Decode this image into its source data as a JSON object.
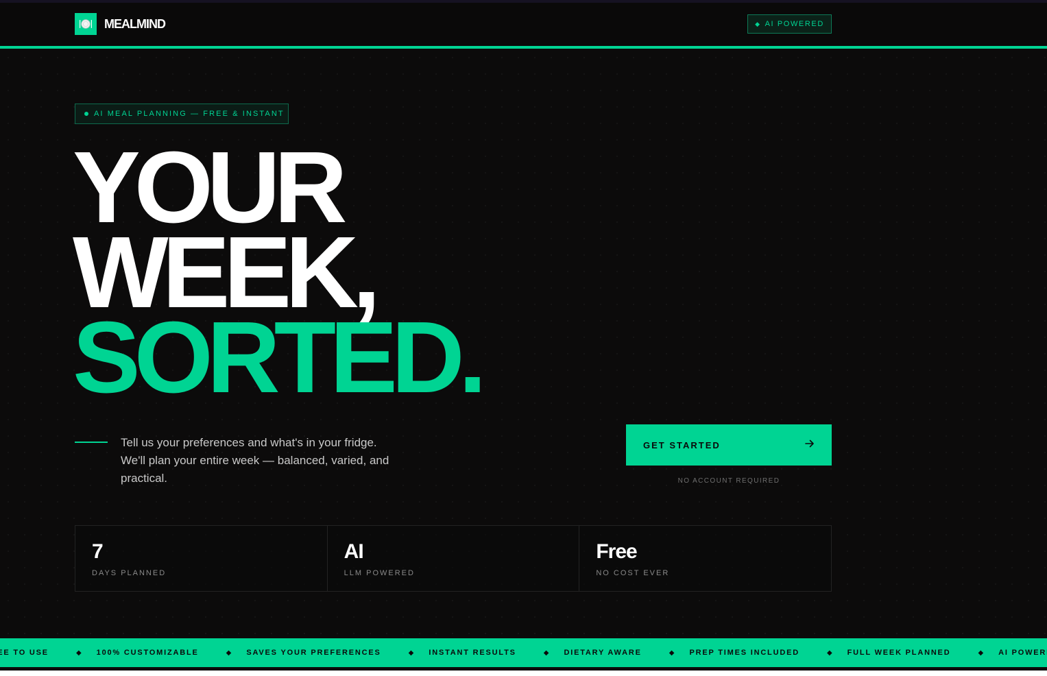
{
  "header": {
    "logo_text": "MEALMIND",
    "logo_icon": "plate-icon",
    "badge_label": "AI POWERED"
  },
  "hero": {
    "eyebrow": "AI MEAL PLANNING — FREE & INSTANT",
    "headline_line1": "YOUR",
    "headline_line2": "WEEK,",
    "headline_line3": "SORTED.",
    "subcopy": "Tell us your preferences and what's in your fridge. We'll plan your entire week — balanced, varied, and practical.",
    "cta_label": "GET STARTED",
    "cta_note": "NO ACCOUNT REQUIRED"
  },
  "stats": [
    {
      "value": "7",
      "label": "DAYS PLANNED"
    },
    {
      "value": "AI",
      "label": "LLM POWERED"
    },
    {
      "value": "Free",
      "label": "NO COST EVER"
    }
  ],
  "ticker": [
    "FREE TO USE",
    "100% CUSTOMIZABLE",
    "SAVES YOUR PREFERENCES",
    "INSTANT RESULTS",
    "DIETARY AWARE",
    "PREP TIMES INCLUDED",
    "FULL WEEK PLANNED",
    "AI POWERED"
  ],
  "colors": {
    "accent": "#00d493",
    "background": "#0c0b0b",
    "text": "#ffffff"
  }
}
